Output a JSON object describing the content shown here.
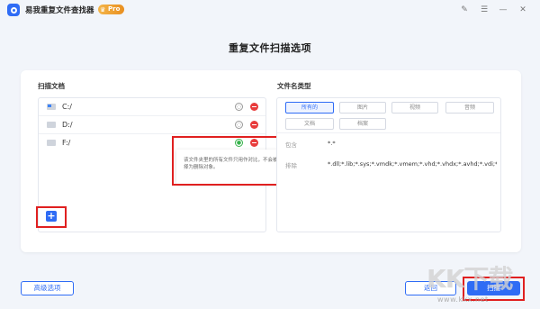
{
  "app": {
    "title": "易我重复文件查找器",
    "badge": "Pro"
  },
  "window_controls": {
    "feedback": "✎",
    "settings": "☰",
    "minimize": "—",
    "close": "✕"
  },
  "page_title": "重复文件扫描选项",
  "scan_section": {
    "label": "扫描文档",
    "drives": [
      {
        "name": "C:/",
        "icon": "os-drive-icon",
        "selected": false
      },
      {
        "name": "D:/",
        "icon": "drive-icon",
        "selected": false
      },
      {
        "name": "F:/",
        "icon": "drive-icon",
        "selected": true
      }
    ],
    "tooltip": "该文件夹里的所有文件只用作对比，不会被选择为删除对象。",
    "add_label": "+"
  },
  "filter_section": {
    "label": "文件名类型",
    "types": [
      {
        "label": "所有的",
        "active": true
      },
      {
        "label": "图片",
        "active": false
      },
      {
        "label": "视频",
        "active": false
      },
      {
        "label": "音频",
        "active": false
      },
      {
        "label": "文档",
        "active": false
      },
      {
        "label": "档案",
        "active": false
      }
    ],
    "include_label": "包含",
    "include_value": "*.*",
    "exclude_label": "排除",
    "exclude_value": "*.dll;*.lib;*.sys;*.vmdk;*.vmem;*.vhd;*.vhdx;*.avhd;*.vdi;*.vbox"
  },
  "buttons": {
    "advanced": "高级选项",
    "back": "返回",
    "scan": "扫描"
  },
  "watermark": {
    "text": "KK下载",
    "url": "www.kkx.net"
  },
  "colors": {
    "accent": "#2f6cf5",
    "highlight": "#e02020",
    "delete": "#e83c3c",
    "selected": "#35b24a"
  }
}
